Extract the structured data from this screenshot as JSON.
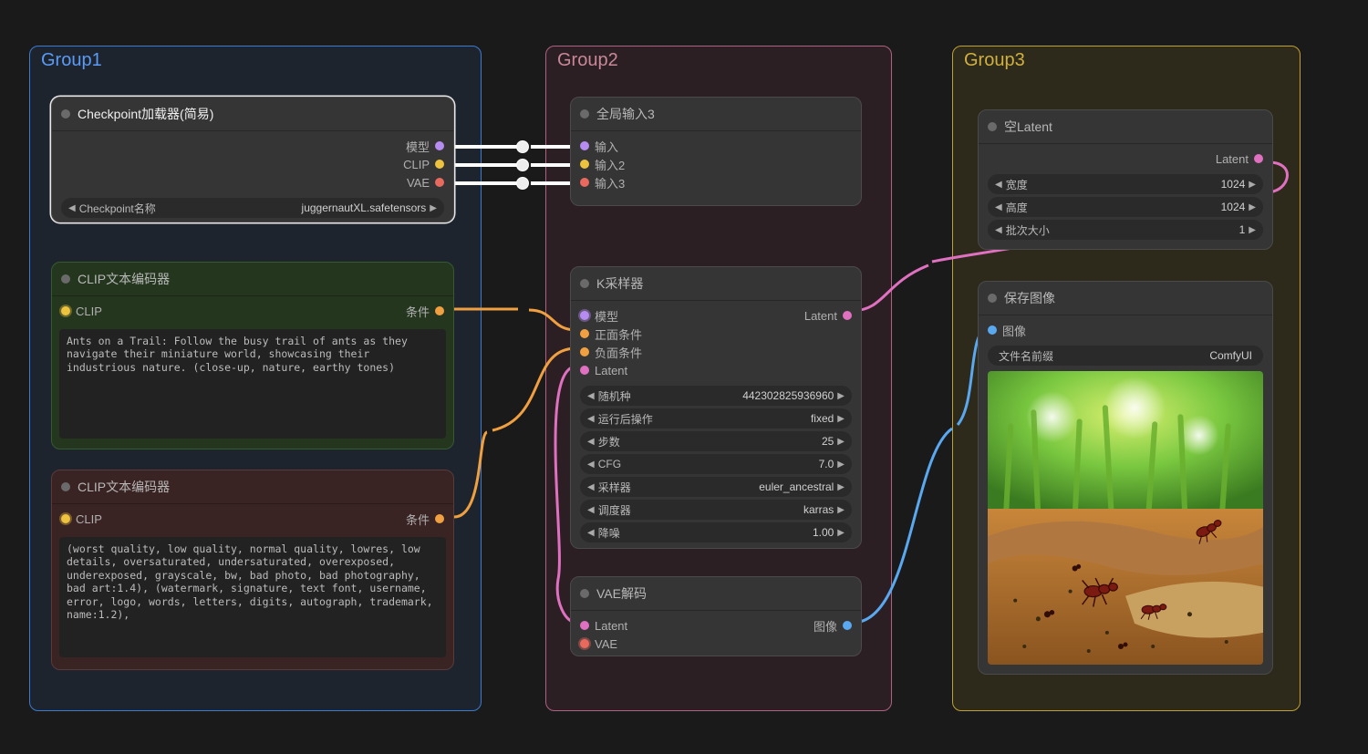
{
  "groups": {
    "g1": {
      "title": "Group1"
    },
    "g2": {
      "title": "Group2"
    },
    "g3": {
      "title": "Group3"
    }
  },
  "nodes": {
    "ckpt": {
      "title": "Checkpoint加载器(简易)",
      "outputs": {
        "model": "模型",
        "clip": "CLIP",
        "vae": "VAE"
      },
      "widgets": {
        "ckpt_name": {
          "label": "Checkpoint名称",
          "value": "juggernautXL.safetensors"
        }
      }
    },
    "clip_pos": {
      "title": "CLIP文本编码器",
      "inputs": {
        "clip": "CLIP"
      },
      "outputs": {
        "cond": "条件"
      },
      "text": "Ants on a Trail: Follow the busy trail of ants as they navigate their miniature world, showcasing their industrious nature. (close-up, nature, earthy tones)"
    },
    "clip_neg": {
      "title": "CLIP文本编码器",
      "inputs": {
        "clip": "CLIP"
      },
      "outputs": {
        "cond": "条件"
      },
      "text": "(worst quality, low quality, normal quality, lowres, low details, oversaturated, undersaturated, overexposed, underexposed, grayscale, bw, bad photo, bad photography, bad art:1.4), (watermark, signature, text font, username, error, logo, words, letters, digits, autograph, trademark, name:1.2),"
    },
    "global_in": {
      "title": "全局输入3",
      "inputs": {
        "in1": "输入",
        "in2": "输入2",
        "in3": "输入3"
      }
    },
    "ksampler": {
      "title": "K采样器",
      "inputs": {
        "model": "模型",
        "pos": "正面条件",
        "neg": "负面条件",
        "latent": "Latent"
      },
      "outputs": {
        "latent": "Latent"
      },
      "widgets": {
        "seed": {
          "label": "随机种",
          "value": "442302825936960"
        },
        "after": {
          "label": "运行后操作",
          "value": "fixed"
        },
        "steps": {
          "label": "步数",
          "value": "25"
        },
        "cfg": {
          "label": "CFG",
          "value": "7.0"
        },
        "sampler": {
          "label": "采样器",
          "value": "euler_ancestral"
        },
        "scheduler": {
          "label": "调度器",
          "value": "karras"
        },
        "denoise": {
          "label": "降噪",
          "value": "1.00"
        }
      }
    },
    "vae_decode": {
      "title": "VAE解码",
      "inputs": {
        "latent": "Latent",
        "vae": "VAE"
      },
      "outputs": {
        "image": "图像"
      }
    },
    "empty_latent": {
      "title": "空Latent",
      "outputs": {
        "latent": "Latent"
      },
      "widgets": {
        "width": {
          "label": "宽度",
          "value": "1024"
        },
        "height": {
          "label": "高度",
          "value": "1024"
        },
        "batch": {
          "label": "批次大小",
          "value": "1"
        }
      }
    },
    "save_image": {
      "title": "保存图像",
      "inputs": {
        "image": "图像"
      },
      "widgets": {
        "prefix": {
          "label": "文件名前缀",
          "value": "ComfyUI"
        }
      }
    }
  }
}
